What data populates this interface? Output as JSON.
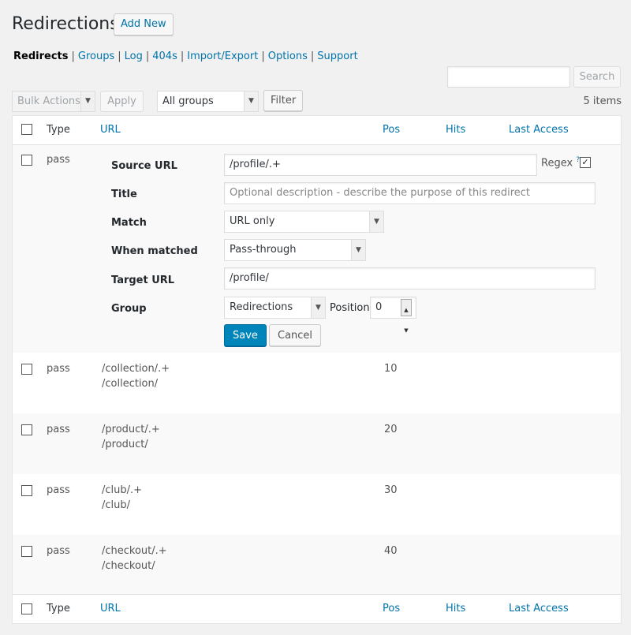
{
  "header": {
    "title": "Redirections",
    "add_new": "Add New"
  },
  "subnav": {
    "items": [
      {
        "label": "Redirects",
        "current": true
      },
      {
        "label": "Groups"
      },
      {
        "label": "Log"
      },
      {
        "label": "404s"
      },
      {
        "label": "Import/Export"
      },
      {
        "label": "Options"
      },
      {
        "label": "Support"
      }
    ],
    "separator": "|"
  },
  "search": {
    "value": "",
    "button": "Search"
  },
  "toolbar": {
    "bulk_actions": "Bulk Actions",
    "apply": "Apply",
    "group_filter": "All groups",
    "filter": "Filter",
    "items_count": "5 items"
  },
  "table": {
    "columns": [
      "Type",
      "URL",
      "Pos",
      "Hits",
      "Last Access"
    ],
    "edit_row": {
      "type": "pass",
      "labels": {
        "source": "Source URL",
        "title": "Title",
        "match": "Match",
        "when_matched": "When matched",
        "target": "Target URL",
        "group": "Group",
        "position": "Position"
      },
      "source_url": "/profile/.+",
      "regex_label": "Regex",
      "regex_help": "?",
      "regex_checked": "✓",
      "title_placeholder": "Optional description - describe the purpose of this redirect",
      "match_value": "URL only",
      "when_matched_value": "Pass-through",
      "target_url": "/profile/",
      "group_value": "Redirections",
      "position_value": "0",
      "save": "Save",
      "cancel": "Cancel"
    },
    "rows": [
      {
        "type": "pass",
        "source": "/collection/.+",
        "target": "/collection/",
        "pos": "10"
      },
      {
        "type": "pass",
        "source": "/product/.+",
        "target": "/product/",
        "pos": "20"
      },
      {
        "type": "pass",
        "source": "/club/.+",
        "target": "/club/",
        "pos": "30"
      },
      {
        "type": "pass",
        "source": "/checkout/.+",
        "target": "/checkout/",
        "pos": "40"
      }
    ]
  },
  "icons": {
    "dropdown": "chevron-down-icon",
    "stepper": "spinner-icon",
    "checkbox": "checkbox-icon"
  },
  "colors": {
    "primary": "#0085ba",
    "link": "#0073aa",
    "background": "#f1f1f1"
  }
}
